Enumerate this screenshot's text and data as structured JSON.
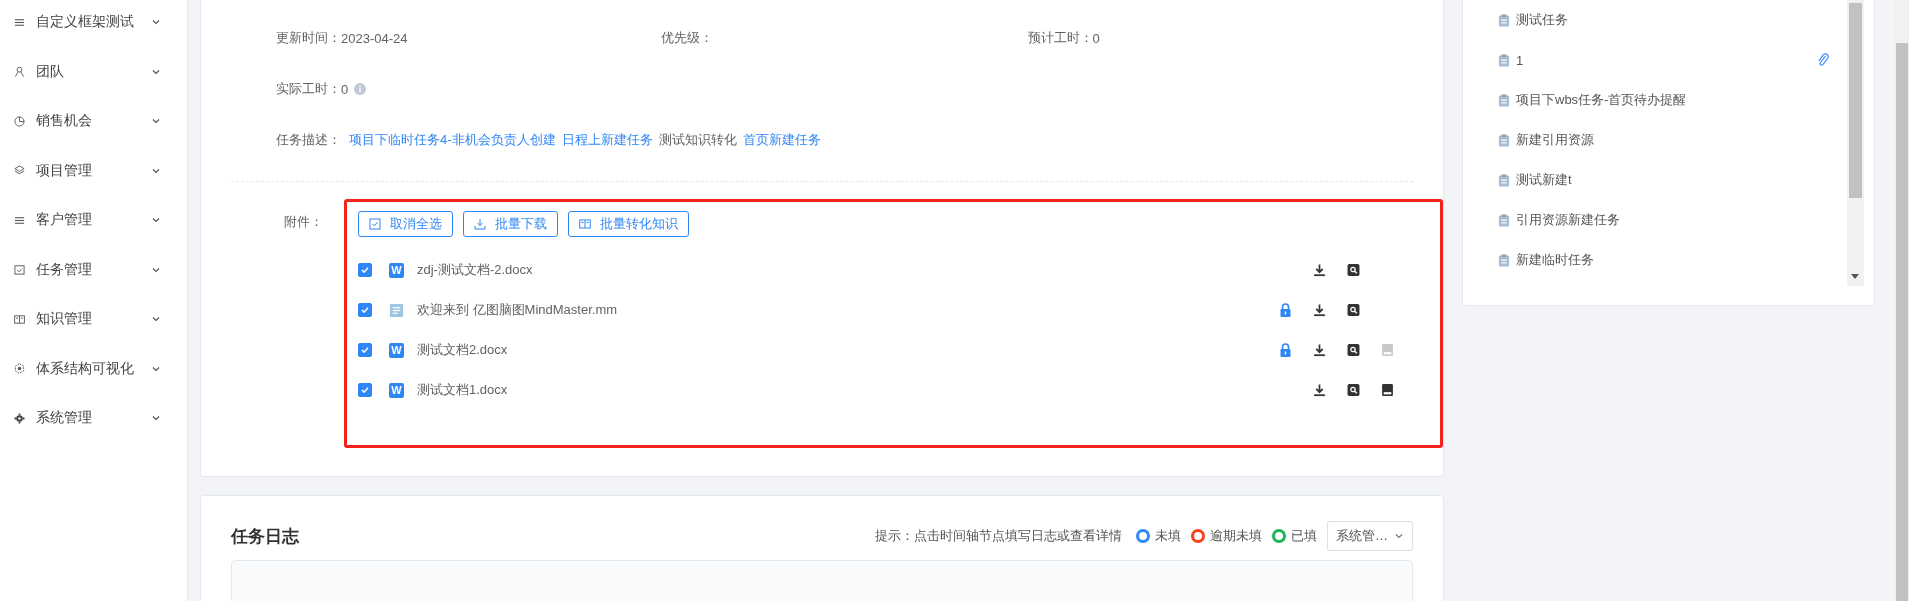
{
  "sidebar": {
    "items": [
      {
        "label": "自定义框架测试",
        "expanded": false
      },
      {
        "label": "团队",
        "expanded": false
      },
      {
        "label": "销售机会",
        "expanded": false
      },
      {
        "label": "项目管理",
        "expanded": false
      },
      {
        "label": "客户管理",
        "expanded": false
      },
      {
        "label": "任务管理",
        "expanded": false
      },
      {
        "label": "知识管理",
        "expanded": false
      },
      {
        "label": "体系结构可视化",
        "expanded": false
      },
      {
        "label": "系统管理",
        "expanded": false
      }
    ]
  },
  "task": {
    "field_rows": [
      [
        {
          "label": "更新时间：",
          "value": "2023-04-24"
        },
        {
          "label": "优先级："
        },
        {
          "label": "预计工时：",
          "value": "0"
        }
      ],
      [
        {
          "label": "实际工时：",
          "value": "0",
          "info": true
        }
      ]
    ],
    "description": {
      "label": "任务描述：",
      "parts": [
        {
          "text": "项目下临时任务4-非机会负责人创建",
          "link": true
        },
        {
          "text": "日程上新建任务",
          "link": true
        },
        {
          "text": "测试知识转化",
          "link": false
        },
        {
          "text": "首页新建任务",
          "link": true
        }
      ]
    }
  },
  "attachments": {
    "label": "附件：",
    "highlighted": true,
    "buttons": [
      "取消全选",
      "批量下载",
      "批量转化知识"
    ],
    "files": [
      {
        "name": "zdj-测试文档-2.docx",
        "checked": true,
        "kind": "word",
        "mark": "W",
        "locked": false,
        "knowledge": false
      },
      {
        "name": "欢迎来到 亿图脑图MindMaster.mm",
        "checked": true,
        "kind": "text",
        "locked": true,
        "knowledge": false
      },
      {
        "name": "测试文档2.docx",
        "checked": true,
        "kind": "word",
        "mark": "W",
        "locked": true,
        "knowledge": true,
        "knowledge_disabled": true
      },
      {
        "name": "测试文档1.docx",
        "checked": true,
        "kind": "word",
        "mark": "W",
        "locked": false,
        "knowledge": true,
        "knowledge_disabled": false
      }
    ]
  },
  "log": {
    "title": "任务日志",
    "hint": "提示：点击时间轴节点填写日志或查看详情",
    "legend": [
      {
        "label": "未填",
        "color": "#2f86f6"
      },
      {
        "label": "逾期未填",
        "color": "#f5421a"
      },
      {
        "label": "已填",
        "color": "#1ab35a"
      }
    ],
    "select": {
      "value": "系统管…"
    }
  },
  "resources": {
    "items": [
      {
        "label": "测试任务",
        "attached": false
      },
      {
        "label": "1",
        "attached": true
      },
      {
        "label": "项目下wbs任务-首页待办提醒",
        "attached": false
      },
      {
        "label": "新建引用资源",
        "attached": false
      },
      {
        "label": "测试新建t",
        "attached": false
      },
      {
        "label": "引用资源新建任务",
        "attached": false
      },
      {
        "label": "新建临时任务",
        "attached": false
      }
    ]
  }
}
